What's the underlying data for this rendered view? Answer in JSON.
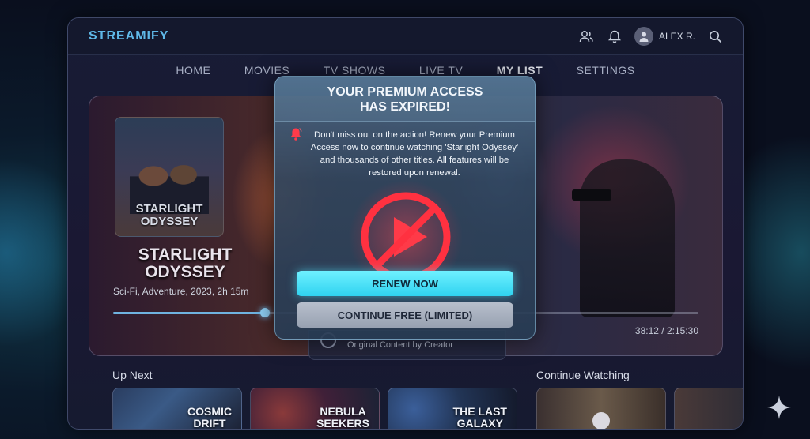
{
  "app": {
    "brand": "STREAMIFY",
    "user_name": "ALEX R."
  },
  "icons": {
    "profile": "people-icon",
    "notifications": "bell-icon",
    "avatar": "avatar-icon",
    "search": "search-icon",
    "warning": "alert-bell-icon",
    "blocked_play": "no-play-icon",
    "sparkle": "sparkle-icon"
  },
  "nav": {
    "items": [
      "HOME",
      "MOVIES",
      "TV SHOWS",
      "LIVE TV",
      "MY LIST",
      "SETTINGS"
    ],
    "active": "MY LIST"
  },
  "hero": {
    "poster_title": "STARLIGHT\nODYSSEY",
    "title": "STARLIGHT\nODYSSEY",
    "meta": "Sci-Fi, Adventure, 2023, 2h 15m",
    "progress": 0.26,
    "time": "38:12 / 2:15:30"
  },
  "behind_card": {
    "text": "Original Content by Creator"
  },
  "up_next": {
    "title": "Up Next",
    "items": [
      "COSMIC\nDRIFT",
      "NEBULA\nSEEKERS",
      "THE LAST\nGALAXY"
    ]
  },
  "continue_watching": {
    "title": "Continue Watching"
  },
  "modal": {
    "title": "YOUR PREMIUM ACCESS\nHAS EXPIRED!",
    "message": "Don't miss out on the action! Renew your Premium Access now to continue watching 'Starlight Odyssey' and thousands of other titles. All features will be restored upon renewal.",
    "renew_label": "RENEW NOW",
    "continue_label": "CONTINUE FREE (LIMITED)"
  },
  "colors": {
    "accent": "#2fd3f0",
    "brand": "#5fb8e8",
    "warning": "#ff3b4a"
  }
}
